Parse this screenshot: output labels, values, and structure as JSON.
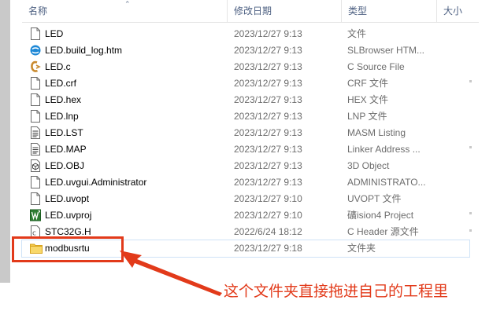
{
  "columns": {
    "name": "名称",
    "date": "修改日期",
    "type": "类型",
    "size": "大小"
  },
  "files": [
    {
      "name": "LED",
      "date": "2023/12/27 9:13",
      "type": "文件",
      "icon": "blank-file-icon"
    },
    {
      "name": "LED.build_log.htm",
      "date": "2023/12/27 9:13",
      "type": "SLBrowser HTM...",
      "icon": "browser-html-icon"
    },
    {
      "name": "LED.c",
      "date": "2023/12/27 9:13",
      "type": "C Source File",
      "icon": "c-source-icon"
    },
    {
      "name": "LED.crf",
      "date": "2023/12/27 9:13",
      "type": "CRF 文件",
      "icon": "blank-file-icon"
    },
    {
      "name": "LED.hex",
      "date": "2023/12/27 9:13",
      "type": "HEX 文件",
      "icon": "blank-file-icon"
    },
    {
      "name": "LED.lnp",
      "date": "2023/12/27 9:13",
      "type": "LNP 文件",
      "icon": "blank-file-icon"
    },
    {
      "name": "LED.LST",
      "date": "2023/12/27 9:13",
      "type": "MASM Listing",
      "icon": "listing-file-icon"
    },
    {
      "name": "LED.MAP",
      "date": "2023/12/27 9:13",
      "type": "Linker Address ...",
      "icon": "listing-file-icon"
    },
    {
      "name": "LED.OBJ",
      "date": "2023/12/27 9:13",
      "type": "3D Object",
      "icon": "object-3d-icon"
    },
    {
      "name": "LED.uvgui.Administrator",
      "date": "2023/12/27 9:13",
      "type": "ADMINISTRATO...",
      "icon": "blank-file-icon"
    },
    {
      "name": "LED.uvopt",
      "date": "2023/12/27 9:10",
      "type": "UVOPT 文件",
      "icon": "blank-file-icon"
    },
    {
      "name": "LED.uvproj",
      "date": "2023/12/27 9:10",
      "type": "礦ision4 Project",
      "icon": "uvision-project-icon"
    },
    {
      "name": "STC32G.H",
      "date": "2022/6/24 18:12",
      "type": "C Header 源文件",
      "icon": "c-header-icon"
    },
    {
      "name": "modbusrtu",
      "date": "2023/12/27 9:18",
      "type": "文件夹",
      "icon": "folder-icon"
    }
  ],
  "annotation": {
    "text": "这个文件夹直接拖进自己的工程里",
    "color": "#e23a1a"
  },
  "colors": {
    "header_text": "#4d6082",
    "secondary_text": "#6d6d6d",
    "annotation": "#e23a1a",
    "selection_border": "#cfe3f7"
  }
}
